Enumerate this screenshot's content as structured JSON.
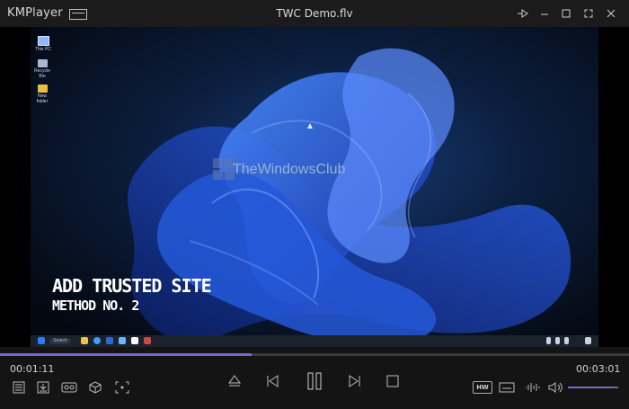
{
  "app": {
    "name": "KMPlayer",
    "file_title": "TWC Demo.flv"
  },
  "window_controls": {
    "pin": "pin-icon",
    "minimize": "minimize-icon",
    "maximize": "maximize-icon",
    "fullscreen": "fullscreen-icon",
    "close": "close-icon"
  },
  "video": {
    "desktop_icons": [
      {
        "label": "This PC",
        "icon": "computer-icon"
      },
      {
        "label": "Recycle Bin",
        "icon": "trash-icon"
      },
      {
        "label": "New folder",
        "icon": "folder-icon"
      }
    ],
    "watermark": "TheWindowsClub",
    "overlay_line1": "ADD TRUSTED SITE",
    "overlay_line2": "METHOD NO. 2",
    "taskbar": {
      "search": "Search"
    }
  },
  "playback": {
    "current_time": "00:01:11",
    "total_time": "00:03:01",
    "progress": 0.4,
    "volume": 0.9
  },
  "controls": {
    "hw_label": "HW"
  },
  "colors": {
    "accent": "#7d67c8",
    "title_bg": "#1b1b1b",
    "control_bg": "#141414"
  }
}
